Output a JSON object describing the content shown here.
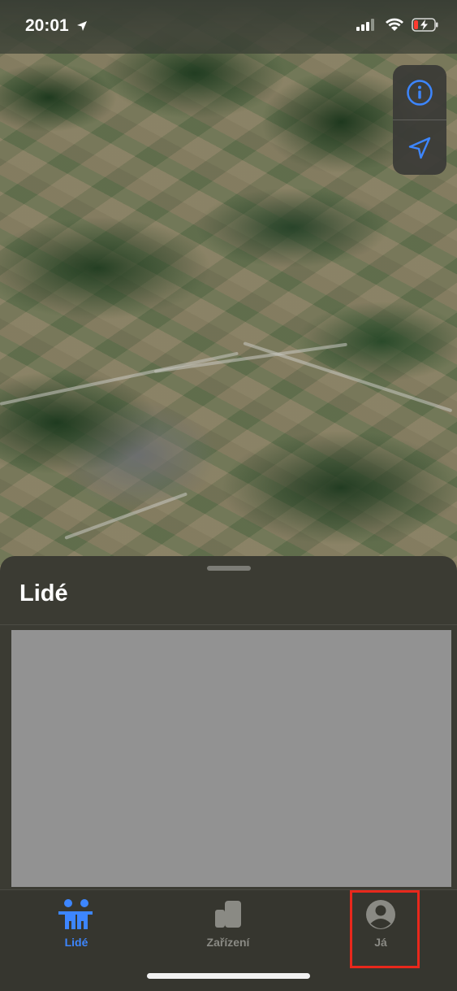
{
  "status_bar": {
    "time": "20:01",
    "icons": [
      "location-arrow-icon",
      "cellular-signal-icon",
      "wifi-icon",
      "battery-charging-icon"
    ]
  },
  "map": {
    "type": "satellite",
    "controls": [
      {
        "name": "info-icon"
      },
      {
        "name": "location-arrow-icon"
      }
    ]
  },
  "sheet": {
    "title": "Lidé",
    "content_redacted": true
  },
  "tabbar": {
    "tabs": [
      {
        "label": "Lidé",
        "icon": "people-icon",
        "active": true
      },
      {
        "label": "Zařízení",
        "icon": "devices-icon",
        "active": false
      },
      {
        "label": "Já",
        "icon": "person-circle-icon",
        "active": false
      }
    ],
    "highlighted_tab": "Já"
  },
  "colors": {
    "accent": "#3d86ff",
    "highlight": "#e8281c",
    "sheet_bg": "#3b3b33"
  }
}
